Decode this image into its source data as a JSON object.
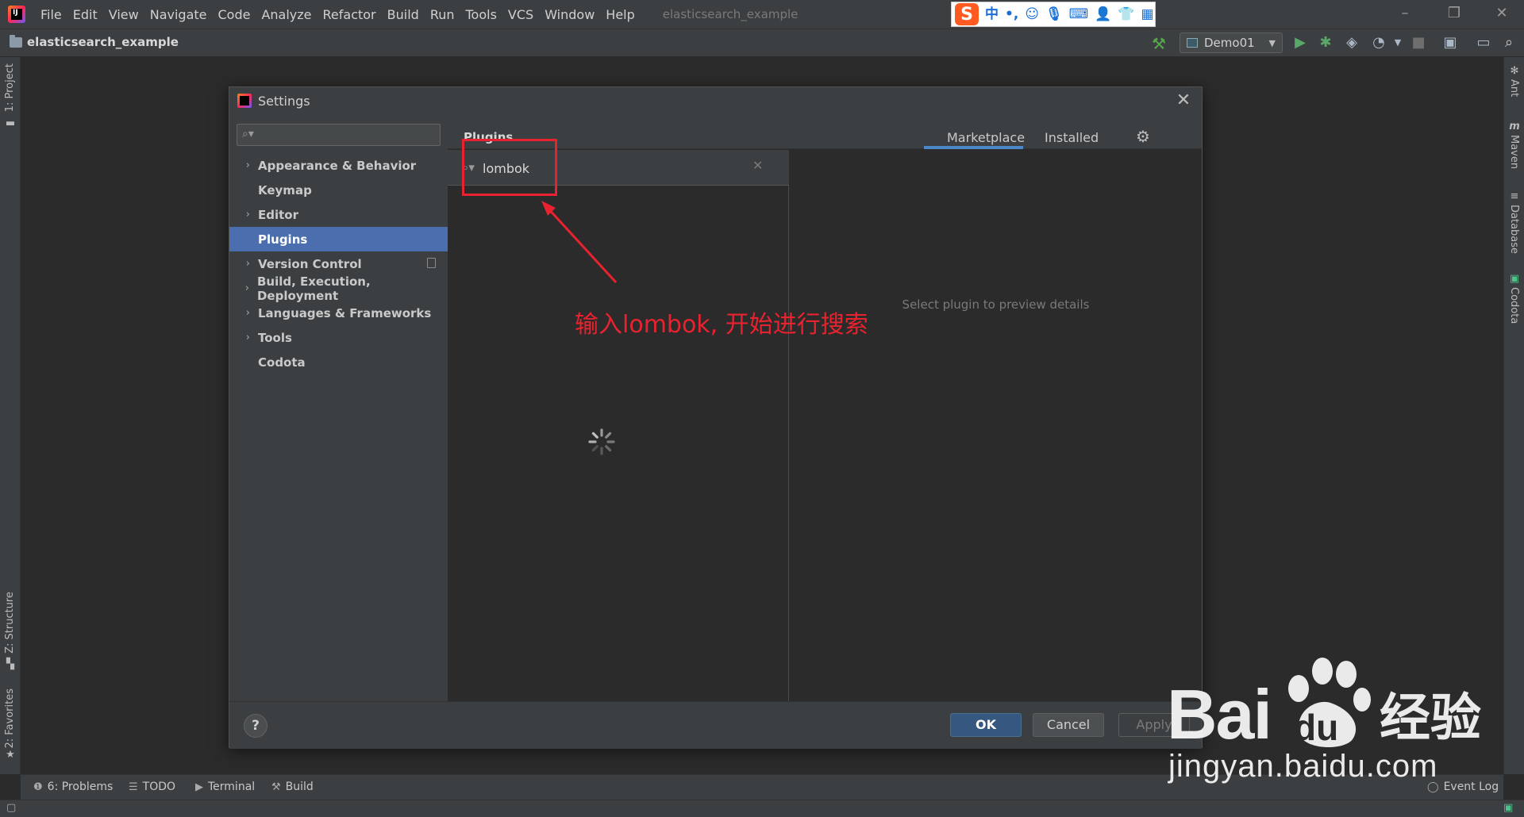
{
  "menubar": {
    "items": [
      "File",
      "Edit",
      "View",
      "Navigate",
      "Code",
      "Analyze",
      "Refactor",
      "Build",
      "Run",
      "Tools",
      "VCS",
      "Window",
      "Help"
    ],
    "window_title": "elasticsearch_example"
  },
  "ime": {
    "logo": "S",
    "lang": "中",
    "punct": "•,",
    "icons": [
      "emoji-icon",
      "microphone-icon",
      "keyboard-icon",
      "user-icon",
      "shirt-icon",
      "grid-icon"
    ]
  },
  "navbar": {
    "project": "elasticsearch_example",
    "run_config": "Demo01"
  },
  "left_stripe": {
    "project_tab": "1: Project",
    "structure_tab": "Z: Structure",
    "favorites_tab": "2: Favorites"
  },
  "right_stripe": {
    "ant": "Ant",
    "maven": "Maven",
    "database": "Database",
    "codota": "Codota"
  },
  "bottom_tools": {
    "problems": "6: Problems",
    "todo": "TODO",
    "terminal": "Terminal",
    "build": "Build",
    "event_log": "Event Log"
  },
  "dialog": {
    "title": "Settings",
    "sidebar": {
      "search_placeholder": "",
      "items": [
        {
          "label": "Appearance & Behavior",
          "expandable": true
        },
        {
          "label": "Keymap",
          "expandable": false
        },
        {
          "label": "Editor",
          "expandable": true
        },
        {
          "label": "Plugins",
          "expandable": false,
          "selected": true
        },
        {
          "label": "Version Control",
          "expandable": true
        },
        {
          "label": "Build, Execution, Deployment",
          "expandable": true
        },
        {
          "label": "Languages & Frameworks",
          "expandable": true
        },
        {
          "label": "Tools",
          "expandable": true
        },
        {
          "label": "Codota",
          "expandable": false
        }
      ]
    },
    "plugins": {
      "title": "Plugins",
      "tabs": {
        "marketplace": "Marketplace",
        "installed": "Installed"
      },
      "search_value": "lombok",
      "details_hint": "Select plugin to preview details"
    },
    "footer": {
      "help": "?",
      "ok": "OK",
      "cancel": "Cancel",
      "apply": "Apply"
    }
  },
  "annotation": {
    "text": "输入lombok, 开始进行搜索",
    "color": "#e8232f"
  },
  "watermark": {
    "bai": "Bai",
    "du": "du",
    "jingyan": "经验",
    "url": "jingyan.baidu.com"
  },
  "colors": {
    "accent": "#4b6eaf",
    "ok_button": "#365880",
    "tab_underline": "#4a88c7"
  }
}
